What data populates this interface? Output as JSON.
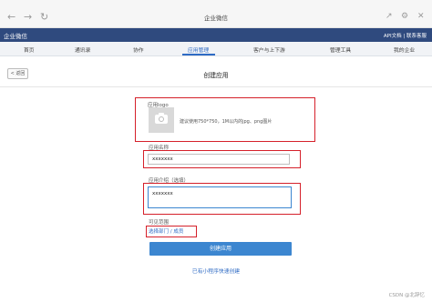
{
  "browser": {
    "back_icon": "arrow-left",
    "forward_icon": "arrow-right",
    "reload_icon": "reload",
    "title": "企业微信"
  },
  "topbar": {
    "brand": "企业微信",
    "api_doc": "API文档",
    "contact": "联系客服"
  },
  "menu": {
    "items": [
      "首页",
      "通讯录",
      "协作",
      "应用管理",
      "客户与上下游",
      "管理工具",
      "我的企业"
    ],
    "active_index": 3
  },
  "subheader": {
    "back_label": "< 返回",
    "title": "创建应用"
  },
  "form": {
    "logo_label": "应用logo",
    "logo_hint": "建议使用750*750，1M以内的jpg、png图片",
    "name_label": "应用名称",
    "name_value": "xxxxxxx",
    "intro_label": "应用介绍（选填）",
    "intro_value": "xxxxxxx",
    "scope_label": "可见范围",
    "scope_link": "选择部门 / 成员",
    "create_button": "创建应用",
    "miniprogram_link": "已有小程序快速创建"
  },
  "watermark": "CSDN @北辞忆",
  "colors": {
    "brand_bar": "#2f4a7e",
    "accent": "#2f6bc4",
    "button": "#3c86d0",
    "highlight": "#d5202a"
  }
}
